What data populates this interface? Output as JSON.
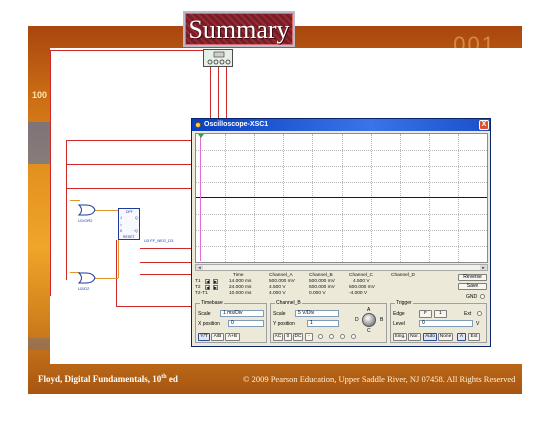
{
  "slide": {
    "title": "Summary",
    "corner_number": "100",
    "top_digits": "001",
    "footer_left_main": "Floyd, Digital Fundamentals, 10",
    "footer_left_sup": "th",
    "footer_left_tail": " ed",
    "footer_right": "© 2009 Pearson Education, Upper Saddle River, NJ 07458. All Rights Reserved"
  },
  "circuit": {
    "gate_labels": [
      "U1/OR2",
      "U2/D2"
    ],
    "ff_labels": [
      "DFF",
      "J",
      "Q",
      ">",
      "~Q",
      "K",
      "RESET"
    ],
    "ff_part_label": "U3 FF_NEG_D3"
  },
  "oscilloscope": {
    "title": "Oscilloscope-XSC1",
    "close_glyph": "X",
    "columns": [
      "Time",
      "Channel_A",
      "Channel_B",
      "Channel_C",
      "Channel_D"
    ],
    "rows": [
      {
        "label": "T1",
        "time": "14.000 ms",
        "a": "500.000 mV",
        "b": "500.000 mV",
        "c": "4.500 V",
        "d": ""
      },
      {
        "label": "T2",
        "time": "24.000 ms",
        "a": "4.500 V",
        "b": "500.000 mV",
        "c": "500.000 mV",
        "d": ""
      },
      {
        "label": "T2-T1",
        "time": "10.000 ms",
        "a": "4.000 V",
        "b": "0.000 V",
        "c": "-4.000 V",
        "d": ""
      }
    ],
    "side_buttons": [
      "Reverse",
      "Save"
    ],
    "gnd_label": "GND",
    "timebase": {
      "group_label": "Timebase",
      "scale_label": "Scale",
      "scale_value": "1 ms/Div",
      "xpos_label": "X position",
      "xpos_value": "0",
      "modes": [
        "Y/T",
        "A/B",
        "A+B"
      ]
    },
    "channel": {
      "group_label": "Channel_B",
      "scale_label": "Scale",
      "scale_value": "5 V/Div",
      "ypos_label": "Y position",
      "ypos_value": "1",
      "coupling": [
        "AC",
        "0",
        "DC",
        "-"
      ],
      "selector": [
        "A",
        "B",
        "C",
        "D"
      ]
    },
    "trigger": {
      "group_label": "Trigger",
      "edge_label": "Edge",
      "edge_rising": "F",
      "edge_falling": "1",
      "ext_label": "Ext",
      "level_label": "Level",
      "level_value": "0",
      "level_unit": "V",
      "modes": [
        "Sing.",
        "Nor.",
        "Auto",
        "None"
      ],
      "source_buttons": [
        "A",
        "Ext"
      ]
    },
    "scroll_left": "◄",
    "scroll_right": "►"
  },
  "colors": {
    "slide_gradient_mid": "#f0a52a",
    "wire_red": "#cc2a2a",
    "wire_orange": "#e0962c",
    "title_box": "#7a1b25",
    "osc_titlebar": "#0a3fbf"
  }
}
